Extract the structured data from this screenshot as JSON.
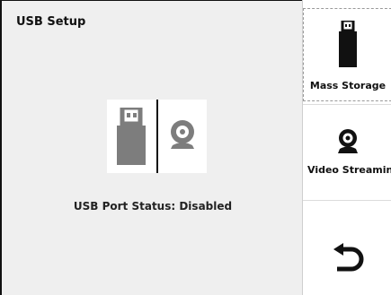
{
  "title": "USB Setup",
  "status": "USB Port Status: Disabled",
  "sidebar": {
    "mass_storage_label": "Mass Storage",
    "video_streaming_label": "Video Streaming",
    "back_icon": "undo-arrow-icon"
  },
  "icons": {
    "usb": "usb-drive-icon",
    "webcam": "webcam-icon"
  }
}
